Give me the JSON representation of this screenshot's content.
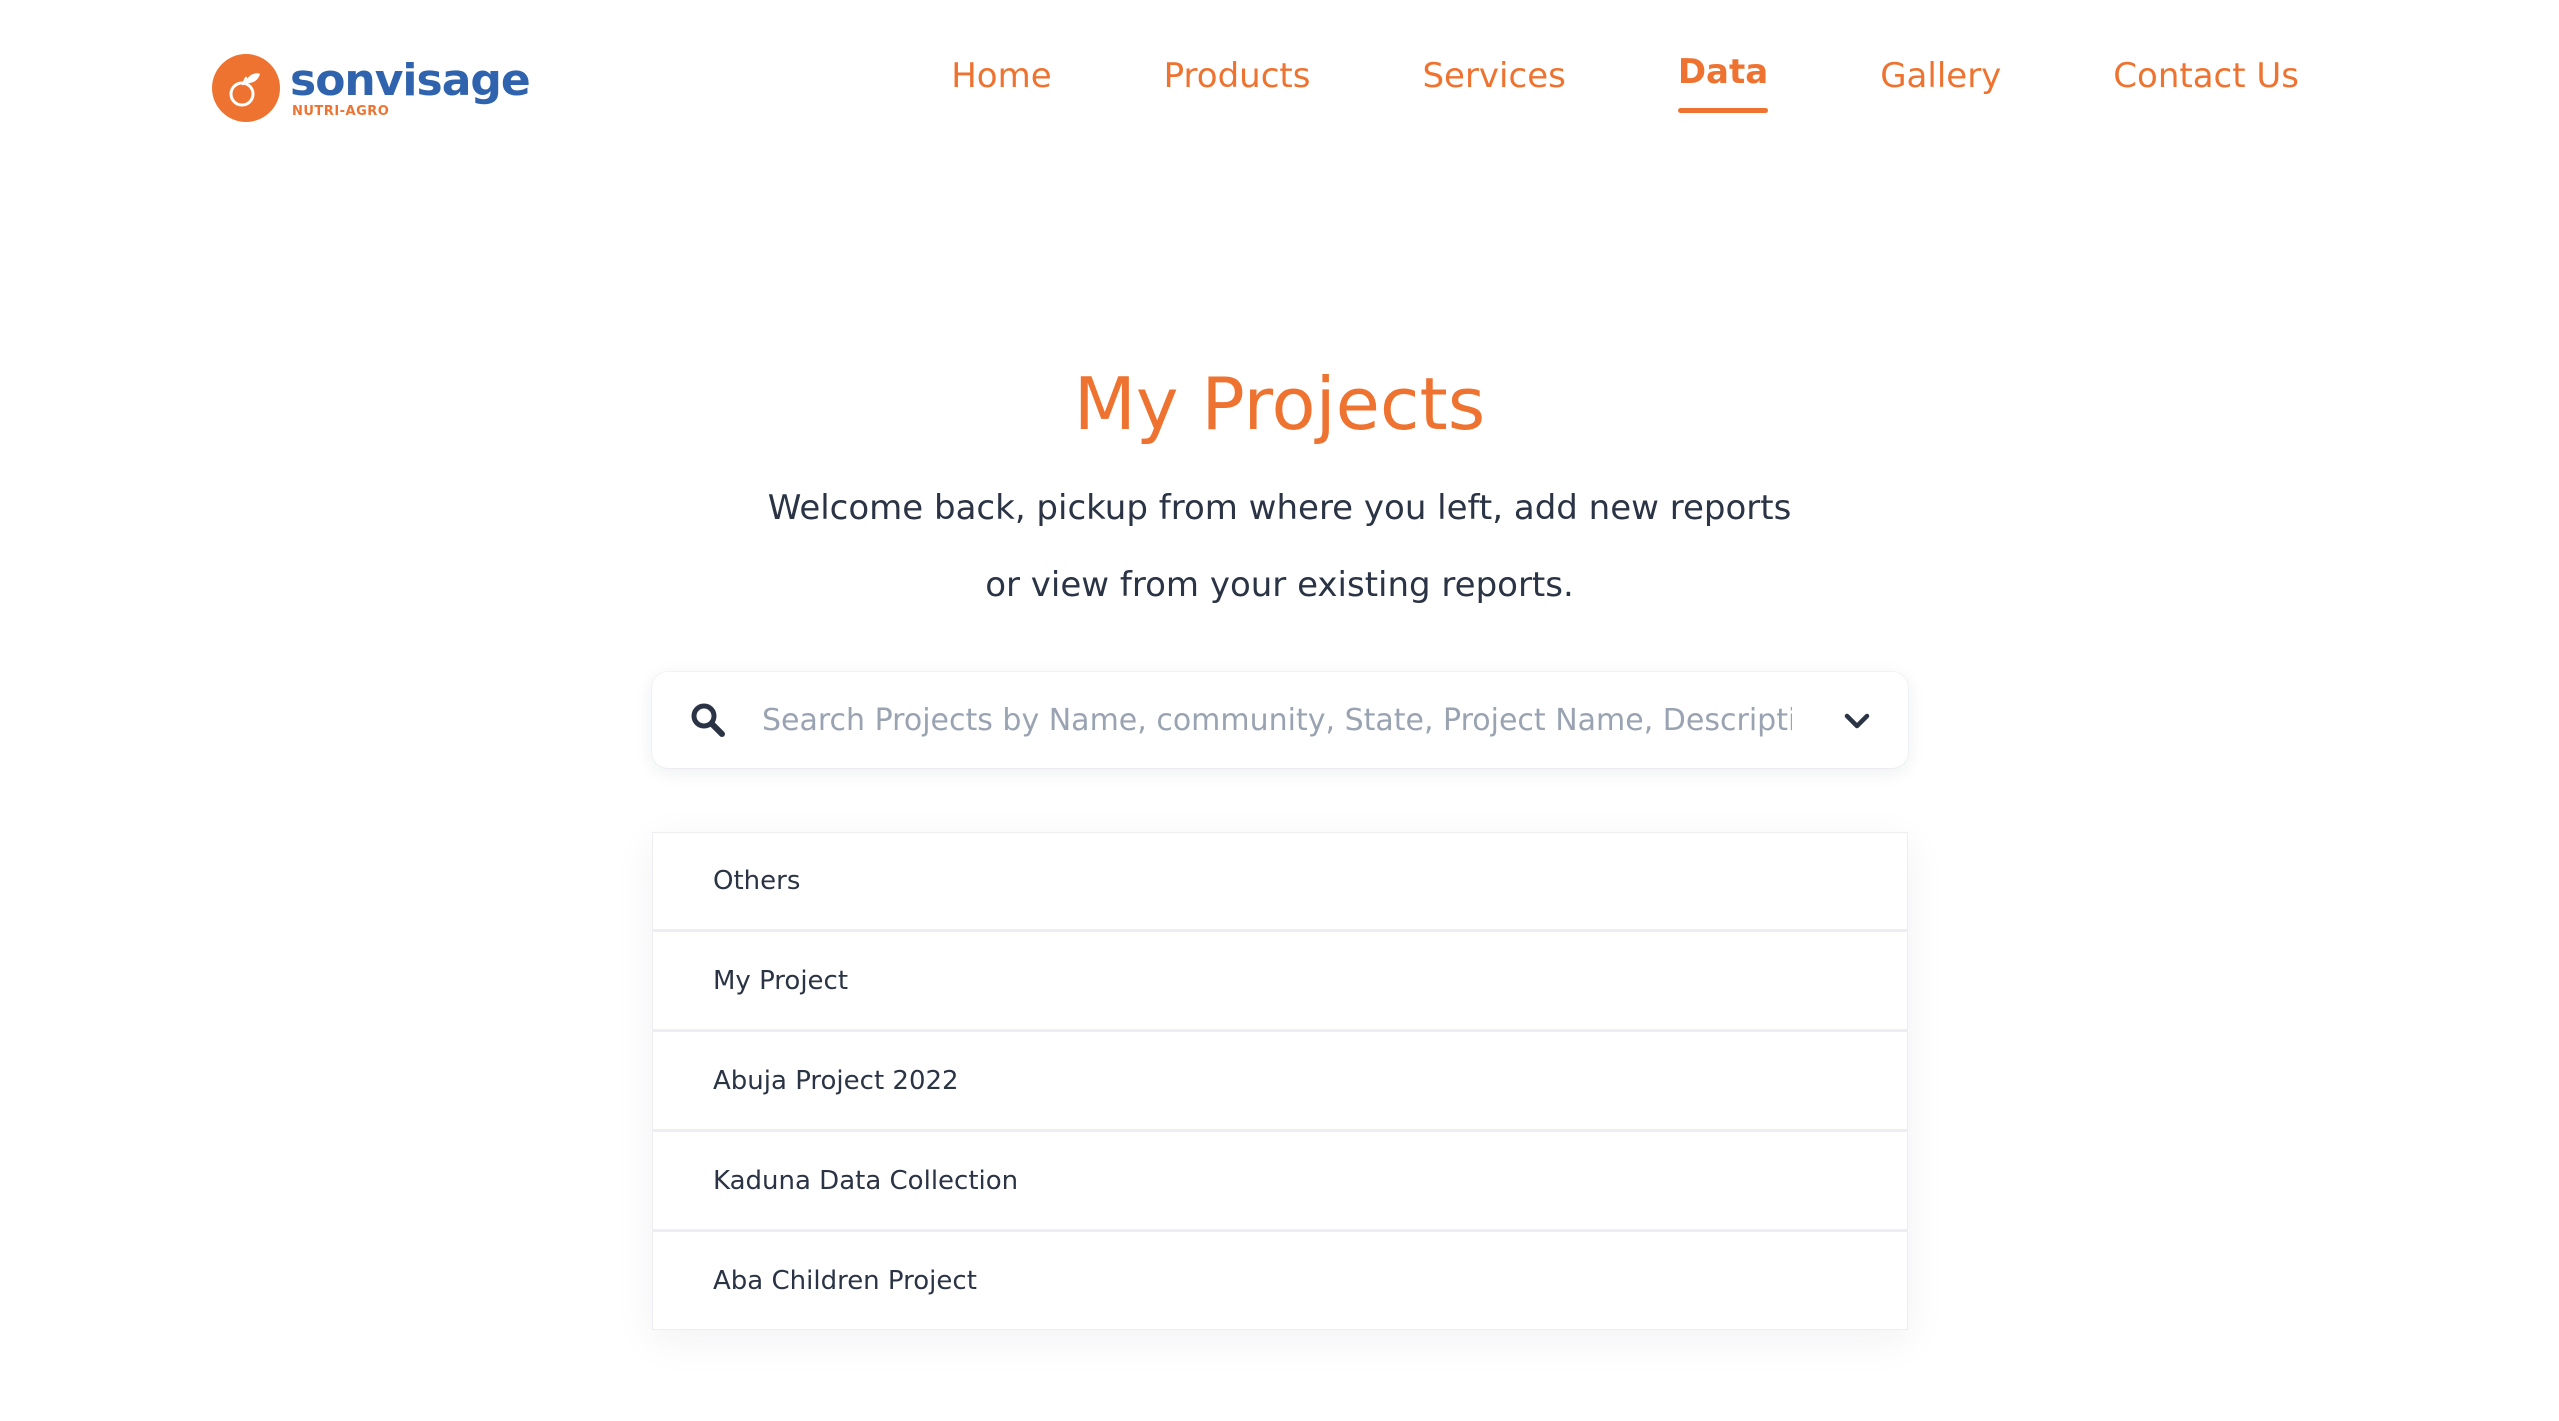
{
  "brand": {
    "name": "sonvisage",
    "tagline": "NUTRI-AGRO",
    "logo_icon": "orange-fruit-icon",
    "primary_color": "#ee7330",
    "secondary_color": "#2f63ad"
  },
  "nav": {
    "items": [
      {
        "label": "Home",
        "active": false
      },
      {
        "label": "Products",
        "active": false
      },
      {
        "label": "Services",
        "active": false
      },
      {
        "label": "Data",
        "active": true
      },
      {
        "label": "Gallery",
        "active": false
      },
      {
        "label": "Contact Us",
        "active": false
      }
    ]
  },
  "main": {
    "title": "My Projects",
    "subtitle_line1": "Welcome back, pickup from where you left, add new reports",
    "subtitle_line2": "or view from your existing reports.",
    "search": {
      "placeholder": "Search Projects by Name, community, State, Project Name, Description,",
      "value": "",
      "icon": "search-icon",
      "toggle_icon": "chevron-down-icon"
    },
    "projects": [
      {
        "label": "Others"
      },
      {
        "label": "My Project"
      },
      {
        "label": "Abuja Project 2022"
      },
      {
        "label": "Kaduna Data Collection"
      },
      {
        "label": "Aba Children Project"
      }
    ]
  }
}
